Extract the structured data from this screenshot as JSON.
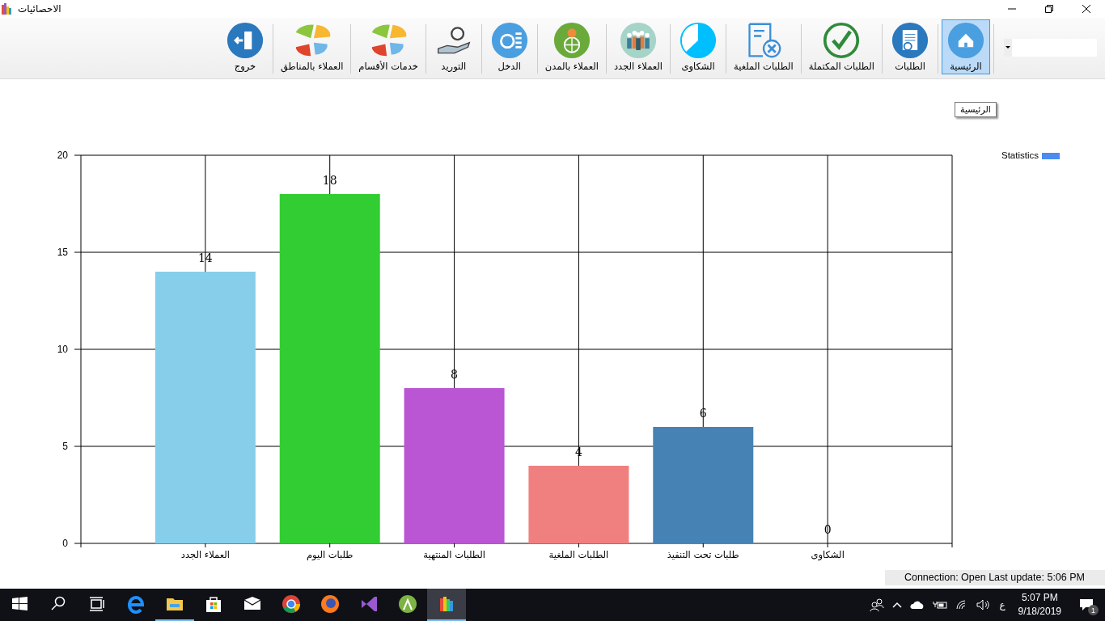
{
  "window": {
    "title": "الاحصائيات"
  },
  "toolbar": {
    "buttons": [
      {
        "label": "الرئيسية",
        "selected": true,
        "separator_after": true
      },
      {
        "label": "الطلبات",
        "selected": false,
        "separator_after": true
      },
      {
        "label": "الطلبات المكتملة",
        "selected": false,
        "separator_after": true
      },
      {
        "label": "الطلبات الملغية",
        "selected": false,
        "separator_after": true
      },
      {
        "label": "الشكاوى",
        "selected": false,
        "separator_after": true
      },
      {
        "label": "العملاء الجدد",
        "selected": false,
        "separator_after": true
      },
      {
        "label": "العملاء بالمدن",
        "selected": false,
        "separator_after": true
      },
      {
        "label": "الدخل",
        "selected": false,
        "separator_after": true
      },
      {
        "label": "التوريد",
        "selected": false,
        "separator_after": true
      },
      {
        "label": "خدمات الأقسام",
        "selected": false,
        "separator_after": true
      },
      {
        "label": "العملاء بالمناطق",
        "selected": false,
        "separator_after": true
      },
      {
        "label": "خروج",
        "selected": false,
        "separator_after": false
      }
    ],
    "tooltip": "الرئيسية"
  },
  "chart": {
    "legend": {
      "label": "Statistics",
      "color": "#4a8cf0"
    },
    "chart_data": {
      "type": "bar",
      "categories": [
        "العملاء الجدد",
        "طلبات اليوم",
        "الطلبات المنتهية",
        "الطلبات الملغية",
        "طلبات تحت التنفيذ",
        "الشكاوى"
      ],
      "series": [
        {
          "color": "#87ceeb",
          "values": [
            14,
            null,
            null,
            null,
            null,
            null
          ]
        },
        {
          "color": "#32cd32",
          "values": [
            null,
            18,
            null,
            null,
            null,
            null
          ]
        },
        {
          "color": "#ba55d3",
          "values": [
            null,
            null,
            8,
            null,
            null,
            null
          ]
        },
        {
          "color": "#f08080",
          "values": [
            null,
            null,
            null,
            4,
            null,
            null
          ]
        },
        {
          "color": "#4682b4",
          "values": [
            null,
            null,
            null,
            null,
            6,
            0
          ]
        }
      ],
      "stacked": true,
      "ylim": [
        0,
        20
      ],
      "yticks": [
        0,
        5,
        10,
        15,
        20
      ],
      "grid": true,
      "data_labels": true
    }
  },
  "status_bar": "Connection: Open Last update: 5:06 PM",
  "taskbar": {
    "apps": [
      {
        "selected": false
      },
      {
        "selected": false
      },
      {
        "selected": false
      },
      {
        "selected": false
      },
      {
        "selected": true
      },
      {
        "selected": false
      },
      {
        "selected": false
      },
      {
        "selected": false
      },
      {
        "selected": false
      },
      {
        "selected": false
      },
      {
        "selected": false
      },
      {
        "selected": true
      }
    ],
    "input_language": "ع",
    "time": "5:07 PM",
    "date": "9/18/2019",
    "notifications": "1"
  }
}
